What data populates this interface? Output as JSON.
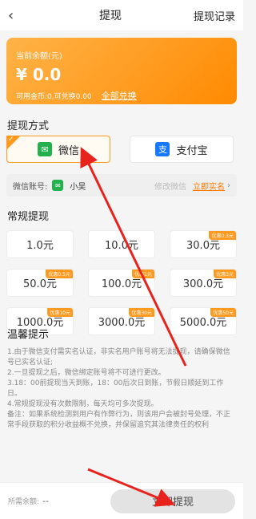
{
  "header": {
    "back_icon": "‹",
    "title": "提现",
    "records": "提现记录"
  },
  "balance": {
    "label": "当前余额(元)",
    "amount": "¥ 0.0",
    "sub": "可用金币:0,可兑换0.00",
    "exchange": "全部兑换"
  },
  "method": {
    "title": "提现方式",
    "wechat": "微信",
    "alipay": "支付宝",
    "selected": "wechat"
  },
  "account": {
    "label": "微信账号:",
    "name": "小吴",
    "modify": "修改微信",
    "verify": "立即实名",
    "chevron": "›"
  },
  "regular": {
    "title": "常规提现",
    "amounts": [
      {
        "value": "1.0元",
        "badge": ""
      },
      {
        "value": "10.0元",
        "badge": ""
      },
      {
        "value": "30.0元",
        "badge": "优惠0.3元"
      },
      {
        "value": "50.0元",
        "badge": "优惠0.5元"
      },
      {
        "value": "100.0元",
        "badge": "优惠1元"
      },
      {
        "value": "300.0元",
        "badge": "优惠3元"
      },
      {
        "value": "1000.0元",
        "badge": "优惠10元"
      },
      {
        "value": "3000.0元",
        "badge": "优惠30元"
      },
      {
        "value": "5000.0元",
        "badge": "优惠50元"
      }
    ]
  },
  "tips": {
    "title": "温馨提示",
    "lines": [
      "1.由于微信支付需实名认证，非实名用户账号将无法提现，请确保微信号已实名认证;",
      "2.一旦提现之后，微信绑定账号将不可进行更改。",
      "3.18：00前提现当天到账，18：00后次日到账，节假日顺延到工作日。",
      "4.常规提现没有次数限制，每天均可多次提现。",
      "备注：如果系统检测到用户有作弊行为，则该用户会被封号处理，不正常手段获取的积分收益概不兑换，并保留追究其法律责任的权利"
    ]
  },
  "footer": {
    "remain_label": "所需余额:",
    "remain_value": "--",
    "submit": "立即提现"
  },
  "colors": {
    "accent": "#ff9a1e",
    "wechat": "#23b14d",
    "alipay": "#1677ff",
    "arrow": "#e8231d"
  }
}
